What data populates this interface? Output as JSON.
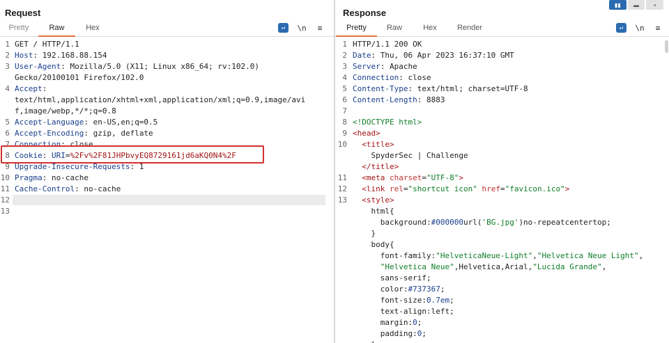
{
  "request": {
    "title": "Request",
    "tabs": [
      "Pretty",
      "Raw",
      "Hex"
    ],
    "active_tab": "Raw",
    "tools": {
      "wrap": "wrap-icon",
      "newline": "\\n",
      "menu": "≡"
    },
    "lines": [
      {
        "n": "1",
        "parts": [
          [
            "v",
            "GET / HTTP/1.1"
          ]
        ]
      },
      {
        "n": "2",
        "parts": [
          [
            "k",
            "Host"
          ],
          [
            "v",
            ": 192.168.88.154"
          ]
        ]
      },
      {
        "n": "3",
        "parts": [
          [
            "k",
            "User-Agent"
          ],
          [
            "v",
            ": Mozilla/5.0 (X11; Linux x86_64; rv:102.0)"
          ]
        ]
      },
      {
        "n": "",
        "parts": [
          [
            "v",
            "Gecko/20100101 Firefox/102.0"
          ]
        ]
      },
      {
        "n": "4",
        "parts": [
          [
            "k",
            "Accept"
          ],
          [
            "v",
            ":"
          ]
        ]
      },
      {
        "n": "",
        "parts": [
          [
            "v",
            "text/html,application/xhtml+xml,application/xml;q=0.9,image/avi"
          ]
        ]
      },
      {
        "n": "",
        "parts": [
          [
            "v",
            "f,image/webp,*/*;q=0.8"
          ]
        ]
      },
      {
        "n": "5",
        "parts": [
          [
            "k",
            "Accept-Language"
          ],
          [
            "v",
            ": en-US,en;q=0.5"
          ]
        ]
      },
      {
        "n": "6",
        "parts": [
          [
            "k",
            "Accept-Encoding"
          ],
          [
            "v",
            ": gzip, deflate"
          ]
        ]
      },
      {
        "n": "7",
        "parts": [
          [
            "k",
            "Connection"
          ],
          [
            "v",
            ": close"
          ]
        ]
      },
      {
        "n": "8",
        "parts": [
          [
            "k",
            "Cookie"
          ],
          [
            "v",
            ": "
          ],
          [
            "k",
            "URI"
          ],
          [
            "v",
            "="
          ],
          [
            "tag",
            "%2Fv%2F81JHPbvyEQ8729161jd6aKQ0N4%2F"
          ]
        ]
      },
      {
        "n": "9",
        "parts": [
          [
            "k",
            "Upgrade-Insecure-Requests"
          ],
          [
            "v",
            ": 1"
          ]
        ]
      },
      {
        "n": "10",
        "parts": [
          [
            "k",
            "Pragma"
          ],
          [
            "v",
            ": no-cache"
          ]
        ]
      },
      {
        "n": "11",
        "parts": [
          [
            "k",
            "Cache-Control"
          ],
          [
            "v",
            ": no-cache"
          ]
        ]
      },
      {
        "n": "12",
        "parts": []
      },
      {
        "n": "13",
        "parts": []
      }
    ]
  },
  "response": {
    "title": "Response",
    "tabs": [
      "Pretty",
      "Raw",
      "Hex",
      "Render"
    ],
    "active_tab": "Pretty",
    "tools": {
      "wrap": "wrap-icon",
      "newline": "\\n",
      "menu": "≡"
    },
    "lines": [
      {
        "n": "1",
        "parts": [
          [
            "v",
            "HTTP/1.1 200 OK"
          ]
        ]
      },
      {
        "n": "2",
        "parts": [
          [
            "k",
            "Date"
          ],
          [
            "v",
            ": Thu, 06 Apr 2023 16:37:10 GMT"
          ]
        ]
      },
      {
        "n": "3",
        "parts": [
          [
            "k",
            "Server"
          ],
          [
            "v",
            ": Apache"
          ]
        ]
      },
      {
        "n": "4",
        "parts": [
          [
            "k",
            "Connection"
          ],
          [
            "v",
            ": close"
          ]
        ]
      },
      {
        "n": "5",
        "parts": [
          [
            "k",
            "Content-Type"
          ],
          [
            "v",
            ": text/html; charset=UTF-8"
          ]
        ]
      },
      {
        "n": "6",
        "parts": [
          [
            "k",
            "Content-Length"
          ],
          [
            "v",
            ": 8883"
          ]
        ]
      },
      {
        "n": "7",
        "parts": []
      },
      {
        "n": "8",
        "parts": [
          [
            "str",
            "<!DOCTYPE html>"
          ]
        ]
      },
      {
        "n": "9",
        "parts": [
          [
            "tag",
            "<head>"
          ]
        ]
      },
      {
        "n": "10",
        "parts": [
          [
            "v",
            "  "
          ],
          [
            "tag",
            "<title>"
          ]
        ]
      },
      {
        "n": "",
        "parts": [
          [
            "v",
            "    SpyderSec | Challenge"
          ]
        ]
      },
      {
        "n": "",
        "parts": [
          [
            "v",
            "  "
          ],
          [
            "tag",
            "</title>"
          ]
        ]
      },
      {
        "n": "11",
        "parts": [
          [
            "v",
            "  "
          ],
          [
            "tag",
            "<meta "
          ],
          [
            "attr",
            "charset"
          ],
          [
            "v",
            "="
          ],
          [
            "str",
            "\"UTF-8\""
          ],
          [
            "tag",
            ">"
          ]
        ]
      },
      {
        "n": "12",
        "parts": [
          [
            "v",
            "  "
          ],
          [
            "tag",
            "<link "
          ],
          [
            "attr",
            "rel"
          ],
          [
            "v",
            "="
          ],
          [
            "str",
            "\"shortcut icon\" "
          ],
          [
            "attr",
            "href"
          ],
          [
            "v",
            "="
          ],
          [
            "str",
            "\"favicon.ico\""
          ],
          [
            "tag",
            ">"
          ]
        ]
      },
      {
        "n": "13",
        "parts": [
          [
            "v",
            "  "
          ],
          [
            "tag",
            "<style>"
          ]
        ]
      },
      {
        "n": "",
        "parts": [
          [
            "v",
            "    html{"
          ]
        ]
      },
      {
        "n": "",
        "parts": [
          [
            "v",
            "      background"
          ],
          [
            "v",
            ":"
          ],
          [
            "k",
            "#000000"
          ],
          [
            "v",
            "url("
          ],
          [
            "str",
            "'BG.jpg'"
          ],
          [
            "v",
            ")no-repeatcentertop;"
          ]
        ]
      },
      {
        "n": "",
        "parts": [
          [
            "v",
            "    }"
          ]
        ]
      },
      {
        "n": "",
        "parts": [
          [
            "v",
            "    body{"
          ]
        ]
      },
      {
        "n": "",
        "parts": [
          [
            "v",
            "      font-family"
          ],
          [
            "v",
            ":"
          ],
          [
            "str",
            "\"HelveticaNeue-Light\""
          ],
          [
            "v",
            ","
          ],
          [
            "str",
            "\"Helvetica Neue Light\""
          ],
          [
            "v",
            ","
          ]
        ]
      },
      {
        "n": "",
        "parts": [
          [
            "v",
            "      "
          ],
          [
            "str",
            "\"Helvetica Neue\""
          ],
          [
            "v",
            ",Helvetica,Arial,"
          ],
          [
            "str",
            "\"Lucida Grande\""
          ],
          [
            "v",
            ","
          ]
        ]
      },
      {
        "n": "",
        "parts": [
          [
            "v",
            "      sans-serif;"
          ]
        ]
      },
      {
        "n": "",
        "parts": [
          [
            "v",
            "      color"
          ],
          [
            "v",
            ":"
          ],
          [
            "k",
            "#737367"
          ],
          [
            "v",
            ";"
          ]
        ]
      },
      {
        "n": "",
        "parts": [
          [
            "v",
            "      font-size"
          ],
          [
            "v",
            ":"
          ],
          [
            "k",
            "0.7em"
          ],
          [
            "v",
            ";"
          ]
        ]
      },
      {
        "n": "",
        "parts": [
          [
            "v",
            "      text-align"
          ],
          [
            "v",
            ":left;"
          ]
        ]
      },
      {
        "n": "",
        "parts": [
          [
            "v",
            "      margin"
          ],
          [
            "v",
            ":"
          ],
          [
            "k",
            "0"
          ],
          [
            "v",
            ";"
          ]
        ]
      },
      {
        "n": "",
        "parts": [
          [
            "v",
            "      padding"
          ],
          [
            "v",
            ":"
          ],
          [
            "k",
            "0"
          ],
          [
            "v",
            ";"
          ]
        ]
      },
      {
        "n": "",
        "parts": [
          [
            "v",
            "    }"
          ]
        ]
      }
    ]
  },
  "layout_buttons": [
    "split-horizontal-icon",
    "split-vertical-icon",
    "single-pane-icon"
  ]
}
